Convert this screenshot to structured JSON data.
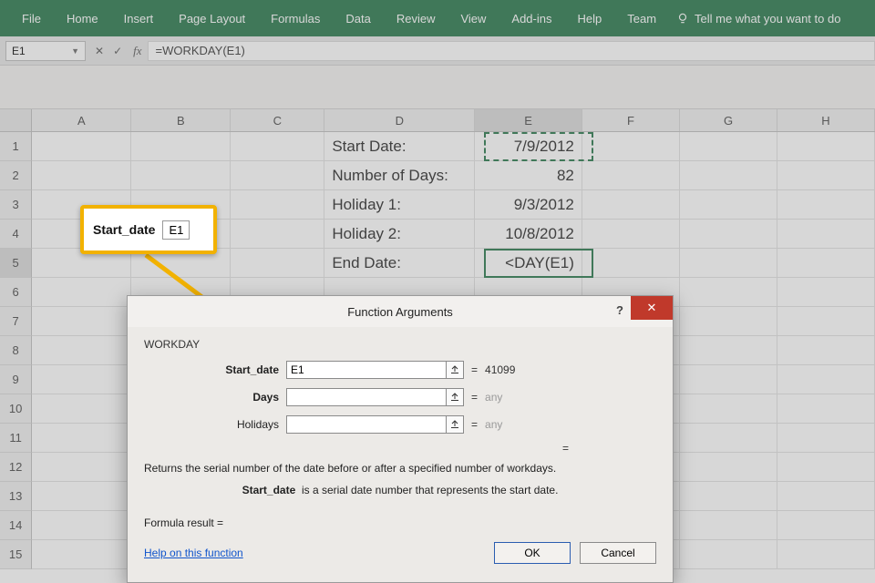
{
  "ribbon": {
    "tabs": [
      "File",
      "Home",
      "Insert",
      "Page Layout",
      "Formulas",
      "Data",
      "Review",
      "View",
      "Add-ins",
      "Help",
      "Team"
    ],
    "tellme": "Tell me what you want to do"
  },
  "namebox": "E1",
  "formula": "=WORKDAY(E1)",
  "columns": [
    "A",
    "B",
    "C",
    "D",
    "E",
    "F",
    "G",
    "H"
  ],
  "row_count": 15,
  "cells": {
    "D1": "Start Date:",
    "E1": "7/9/2012",
    "D2": "Number of Days:",
    "E2": "82",
    "D3": "Holiday 1:",
    "E3": "9/3/2012",
    "D4": "Holiday 2:",
    "E4": "10/8/2012",
    "D5": "End Date:",
    "E5": "<DAY(E1)"
  },
  "selected_cell": "E5",
  "marching_cell": "E1",
  "callout": {
    "label": "Start_date",
    "value": "E1"
  },
  "dialog": {
    "title": "Function Arguments",
    "func": "WORKDAY",
    "args": [
      {
        "name": "Start_date",
        "value": "E1",
        "result": "41099",
        "bold": true
      },
      {
        "name": "Days",
        "value": "",
        "result": "any",
        "bold": true,
        "dim": true
      },
      {
        "name": "Holidays",
        "value": "",
        "result": "any",
        "bold": false,
        "dim": true
      }
    ],
    "equals": "=",
    "desc": "Returns the serial number of the date before or after a specified number of workdays.",
    "arg_desc_name": "Start_date",
    "arg_desc_text": "is a serial date number that represents the start date.",
    "formula_result_label": "Formula result =",
    "help": "Help on this function",
    "ok": "OK",
    "cancel": "Cancel"
  }
}
